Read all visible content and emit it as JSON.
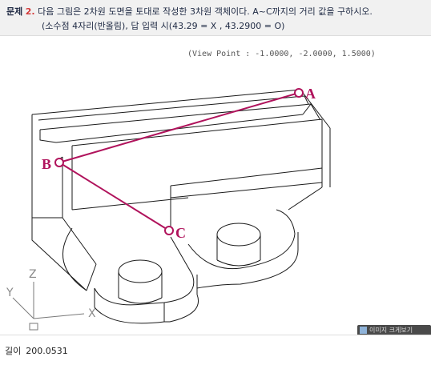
{
  "header": {
    "problem_label": "문제",
    "problem_number": "2.",
    "question_line1": "다음 그림은 2차원 도면을 토대로 작성한 3차원 객체이다. A~C까지의 거리 값을 구하시오.",
    "question_line2": "(소수점 4자리(반올림), 답 입력 시(43.29 = X , 43.2900 = O)"
  },
  "drawing": {
    "view_point": "(View Point : -1.0000, -2.0000, 1.5000)",
    "point_labels": {
      "a": "A",
      "b": "B",
      "c": "C"
    },
    "axis_labels": {
      "z": "Z",
      "y": "Y",
      "x": "X"
    },
    "wire_color": "#1a1a1a",
    "path_color": "#b0135c"
  },
  "answer": {
    "label": "길이",
    "value": "200.0531"
  },
  "mini_button": {
    "label": "이미지 크게보기"
  }
}
